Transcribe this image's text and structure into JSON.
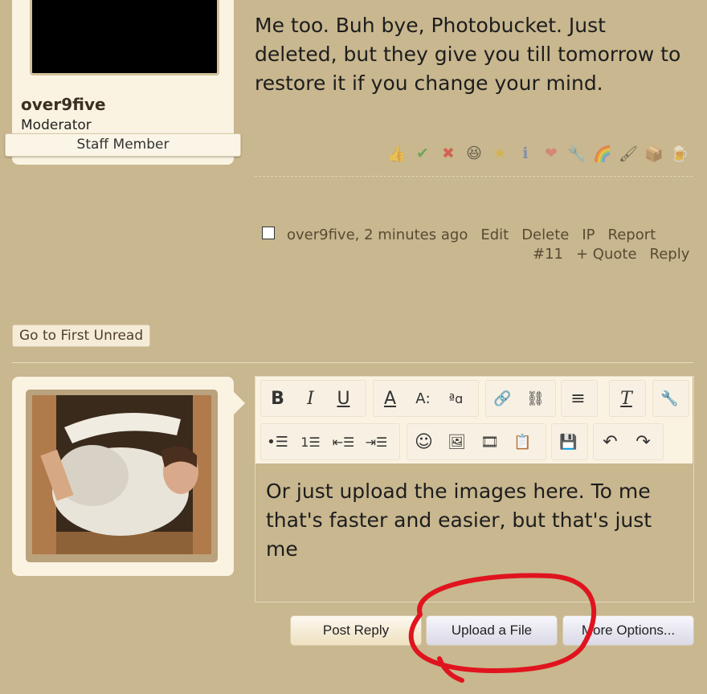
{
  "author": {
    "username": "over9five",
    "role": "Moderator",
    "badge": "Staff Member"
  },
  "post": {
    "message": "Me too. Buh bye, Photobucket. Just deleted, but they give you till tomorrow to restore it if you change your mind.",
    "reactions": [
      "thumbs-up-icon",
      "check-icon",
      "x-icon",
      "laugh-icon",
      "star-icon",
      "info-icon",
      "heart-icon",
      "wrench-icon",
      "rainbow-icon",
      "paintbrush-icon",
      "box-icon",
      "mug-icon"
    ],
    "author_time": "over9five, 2 minutes ago",
    "actions": [
      "Edit",
      "Delete",
      "IP",
      "Report"
    ],
    "number": "#11",
    "quote": "+ Quote",
    "reply": "Reply"
  },
  "go_to_first_unread": "Go to First Unread",
  "editor": {
    "text": "Or just upload the images here. To me that's faster and easier, but that's just me"
  },
  "buttons": {
    "post_reply": "Post Reply",
    "upload_file": "Upload a File",
    "more_options": "More Options..."
  },
  "colors": {
    "background": "#c8b78f",
    "card": "#fbf3e2",
    "annotation": "#e0141e"
  }
}
